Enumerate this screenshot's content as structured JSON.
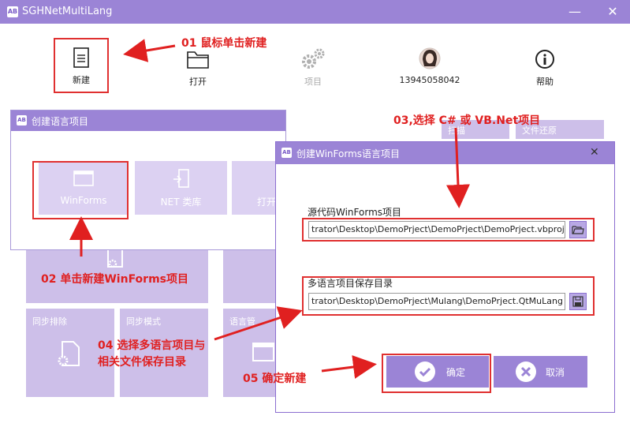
{
  "window": {
    "title": "SGHNetMultiLang",
    "icon_text": "AB",
    "minimize_glyph": "—",
    "close_glyph": "✕"
  },
  "toolbar": {
    "new_label": "新建",
    "open_label": "打开",
    "project_label": "项目",
    "user_label": "13945058042",
    "help_label": "帮助"
  },
  "background_tiles": {
    "scan_label": "扫描",
    "restore_label": "文件还原",
    "sync_sort_label": "同步排除",
    "sync_mode_label": "同步模式",
    "lang_partial_label": "语言管"
  },
  "create_dialog": {
    "title": "创建语言项目",
    "icon_text": "AB",
    "winforms_label": "WinForms",
    "net_lib_label": "NET 类库",
    "open_partial_label": "打开"
  },
  "winforms_dialog": {
    "title": "创建WinForms语言项目",
    "icon_text": "AB",
    "close_glyph": "✕",
    "source_label": "源代码WinForms项目",
    "source_value": "trator\\Desktop\\DemoPrject\\DemoPrject\\DemoPrject.vbproj",
    "save_label": "多语言项目保存目录",
    "save_value": "trator\\Desktop\\DemoPrject\\Mulang\\DemoPrject.QtMuLang",
    "ok_label": "确定",
    "cancel_label": "取消"
  },
  "annotations": {
    "a01": "01 鼠标单击新建",
    "a02": "02 单击新建WinForms项目",
    "a03": "03,选择 C# 或 VB.Net项目",
    "a04_line1": "04 选择多语言项目与",
    "a04_line2": "相关文件保存目录",
    "a05": "05 确定新建"
  },
  "colors": {
    "accent": "#9b84d6",
    "annotation": "#e02020",
    "tile": "#cdbfe9"
  }
}
